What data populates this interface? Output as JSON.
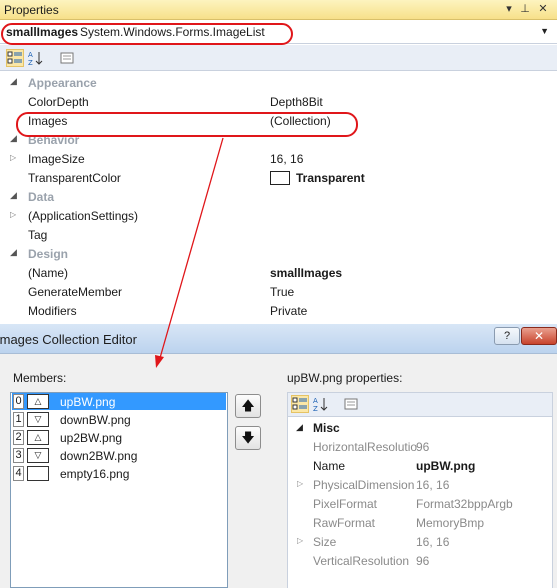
{
  "properties": {
    "title": "Properties",
    "pin_icon": "pin-icon",
    "close_icon": "close-icon",
    "object_name": "smallImages",
    "object_type": "System.Windows.Forms.ImageList",
    "rows": [
      {
        "kind": "category",
        "name": "Appearance"
      },
      {
        "kind": "prop",
        "name": "ColorDepth",
        "value": "Depth8Bit"
      },
      {
        "kind": "prop",
        "name": "Images",
        "value": "(Collection)"
      },
      {
        "kind": "category",
        "name": "Behavior"
      },
      {
        "kind": "prop",
        "name": "ImageSize",
        "value": "16, 16"
      },
      {
        "kind": "prop",
        "name": "TransparentColor",
        "value": "Transparent"
      },
      {
        "kind": "category",
        "name": "Data"
      },
      {
        "kind": "prop",
        "name": "(ApplicationSettings)",
        "value": ""
      },
      {
        "kind": "prop",
        "name": "Tag",
        "value": ""
      },
      {
        "kind": "category",
        "name": "Design"
      },
      {
        "kind": "prop",
        "name": "(Name)",
        "value": "smallImages"
      },
      {
        "kind": "prop",
        "name": "GenerateMember",
        "value": "True"
      },
      {
        "kind": "prop",
        "name": "Modifiers",
        "value": "Private"
      }
    ]
  },
  "editor": {
    "title": "Images Collection Editor",
    "help_label": "?",
    "close_label": "✕",
    "members_label": "Members:",
    "members": [
      {
        "index": "0",
        "name": "upBW.png",
        "icon": "△"
      },
      {
        "index": "1",
        "name": "downBW.png",
        "icon": "▽"
      },
      {
        "index": "2",
        "name": "up2BW.png",
        "icon": "△"
      },
      {
        "index": "3",
        "name": "down2BW.png",
        "icon": "▽"
      },
      {
        "index": "4",
        "name": "empty16.png",
        "icon": ""
      }
    ],
    "move_up_icon": "arrow-up-icon",
    "move_down_icon": "arrow-down-icon",
    "properties_label": "upBW.png properties:",
    "category": "Misc",
    "props": [
      {
        "name": "HorizontalResolutio",
        "value": "96"
      },
      {
        "name": "Name",
        "value": "upBW.png"
      },
      {
        "name": "PhysicalDimension",
        "value": "16, 16"
      },
      {
        "name": "PixelFormat",
        "value": "Format32bppArgb"
      },
      {
        "name": "RawFormat",
        "value": "MemoryBmp"
      },
      {
        "name": "Size",
        "value": "16, 16"
      },
      {
        "name": "VerticalResolution",
        "value": "96"
      }
    ]
  },
  "colors": {
    "highlight_circle": "#e0161a",
    "selection": "#3399ff",
    "title_gold": "#f7e08a"
  }
}
